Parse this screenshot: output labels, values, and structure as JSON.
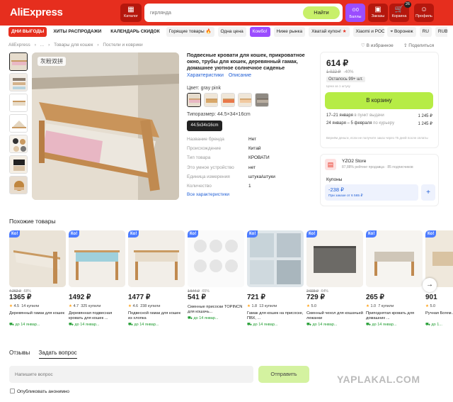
{
  "header": {
    "logo": "AliExpress",
    "catalog": "Каталог",
    "search_placeholder": "гирлянда",
    "search_button": "Найти",
    "bonus_value": "0",
    "bonus_label": "Баллы",
    "orders_label": "Заказы",
    "cart_label": "Корзина",
    "cart_count": "26",
    "profile_label": "Профиль"
  },
  "nav": {
    "items": [
      "ДНИ ВЫГОДЫ",
      "ХИТЫ РАСПРОДАЖИ",
      "КАЛЕНДАРЬ СКИДОК",
      "Горящие товары",
      "Одна цена",
      "Комбо!",
      "Ниже рынка",
      "Хватай купон!",
      "Xiaomi и POCO"
    ],
    "location": "Воронеж",
    "lang": "RU",
    "currency": "RUB"
  },
  "breadcrumbs": [
    "AliExpress",
    "...",
    "Товары для кошек",
    "Постели и коврики"
  ],
  "actions": {
    "favorite": "В избранное",
    "share": "Поделиться"
  },
  "gallery": {
    "caption": "灰粉双拼"
  },
  "product": {
    "title": "Подвесные кровати для кошек, прикроватное окно, трубы для кошек, деревянный гамак, домашнее уютное солнечное сиденье",
    "tab_specs": "Характеристики",
    "tab_desc": "Описание",
    "color_label": "Цвет: gray pink",
    "size_label": "Типоразмер: 44.5×34×16cm",
    "size_value": "44.5x34x16cm",
    "specs": [
      {
        "k": "Название бренда",
        "v": "Нет"
      },
      {
        "k": "Происхождение",
        "v": "Китай"
      },
      {
        "k": "Тип товара",
        "v": "КРОВАТИ"
      },
      {
        "k": "Это умное устройство",
        "v": "нет"
      },
      {
        "k": "Единица измерения",
        "v": "штука/штуки"
      },
      {
        "k": "Количество",
        "v": "1"
      }
    ],
    "all_specs": "Все характеристики"
  },
  "buy": {
    "price": "614 ₽",
    "old_price": "1 022 ₽",
    "discount": "-40%",
    "stock": "Осталось 99+ шт.",
    "per_unit": "Цена за 1 штуку",
    "cart_button": "В корзину",
    "delivery": [
      {
        "dates": "17–21 января",
        "where": " в пункт выдачи",
        "price": "1 245 ₽"
      },
      {
        "dates": "24 января – 5 февраля",
        "where": " по курьеру",
        "price": "1 245 ₽"
      }
    ],
    "refund": "Вернём деньги, если не получите заказ через 75 дней после оплаты"
  },
  "store": {
    "name": "YZO2 Store",
    "rating": "87,88% рейтинг продавца · 85 подписчиков",
    "coupons_label": "Купоны",
    "coupon_amount": "-238 ₽",
    "coupon_condition": "При заказе от 6 565 ₽",
    "coupon_add": "+"
  },
  "similar": {
    "title": "Похожие товары",
    "badge": "Ко!",
    "items": [
      {
        "old": "4 262 ₽",
        "disc": "-68%",
        "price": "1365 ₽",
        "rating": "4.5",
        "sold": "14 купили",
        "name": "Деревянный гамак для кошек",
        "delivery": "до 14 январ..."
      },
      {
        "old": "",
        "disc": "",
        "price": "1492 ₽",
        "rating": "4.7",
        "sold": "325 купили",
        "name": "Деревянная подвесная кровать для кошек ...",
        "delivery": "до 14 январ..."
      },
      {
        "old": "",
        "disc": "",
        "price": "1477 ₽",
        "rating": "4.6",
        "sold": "238 купили",
        "name": "Подвесной гамак для кошек из хлопка",
        "delivery": "до 14 январ..."
      },
      {
        "old": "1 544 ₽",
        "disc": "-65%",
        "price": "541 ₽",
        "rating": "",
        "sold": "",
        "name": "Сменные присоски TOPINCN для кошачь...",
        "delivery": "до 14 январ..."
      },
      {
        "old": "",
        "disc": "",
        "price": "721 ₽",
        "rating": "1.8",
        "sold": "13 купили",
        "name": "Гамак для кошек на присоске, ПВХ, ...",
        "delivery": "до 14 январ..."
      },
      {
        "old": "2 023 ₽",
        "disc": "-64%",
        "price": "729 ₽",
        "rating": "5.0",
        "sold": "",
        "name": "Сменный чехол для кошачьей лежанки",
        "delivery": "до 14 январ..."
      },
      {
        "old": "",
        "disc": "",
        "price": "265 ₽",
        "rating": "1.0",
        "sold": "7 купили",
        "name": "Приподнятая кровать для домашних ...",
        "delivery": "до 14 январ..."
      },
      {
        "old": "",
        "disc": "",
        "price": "901",
        "rating": "5.0",
        "sold": "",
        "name": "Ручная Богем...",
        "delivery": "до 1..."
      }
    ]
  },
  "reviews": {
    "tab_reviews": "Отзывы",
    "tab_ask": "Задать вопрос",
    "input_placeholder": "Напишите вопрос",
    "send": "Отправить",
    "anonymous": "Опубликовать анонимно"
  },
  "watermark": "YAPLAKAL.COM"
}
